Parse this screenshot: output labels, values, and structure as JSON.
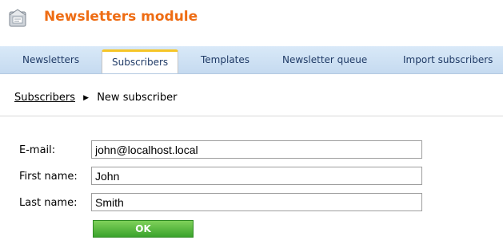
{
  "module": {
    "title": "Newsletters module",
    "icon": "newsletter-module-icon"
  },
  "tabs": [
    {
      "label": "Newsletters",
      "active": false
    },
    {
      "label": "Subscribers",
      "active": true
    },
    {
      "label": "Templates",
      "active": false
    },
    {
      "label": "Newsletter queue",
      "active": false
    },
    {
      "label": "Import subscribers",
      "active": false
    }
  ],
  "breadcrumb": {
    "parent": "Subscribers",
    "current": "New subscriber",
    "separator_icon": "triangle-right-icon"
  },
  "form": {
    "email_label": "E-mail:",
    "email_value": "john@localhost.local",
    "first_name_label": "First name:",
    "first_name_value": "John",
    "last_name_label": "Last name:",
    "last_name_value": "Smith",
    "ok_label": "OK"
  },
  "colors": {
    "title": "#ee6c13",
    "tabbar": "#c9dcf1",
    "active_tab_accent": "#f6c526",
    "ok_button": "#4caf3a"
  }
}
